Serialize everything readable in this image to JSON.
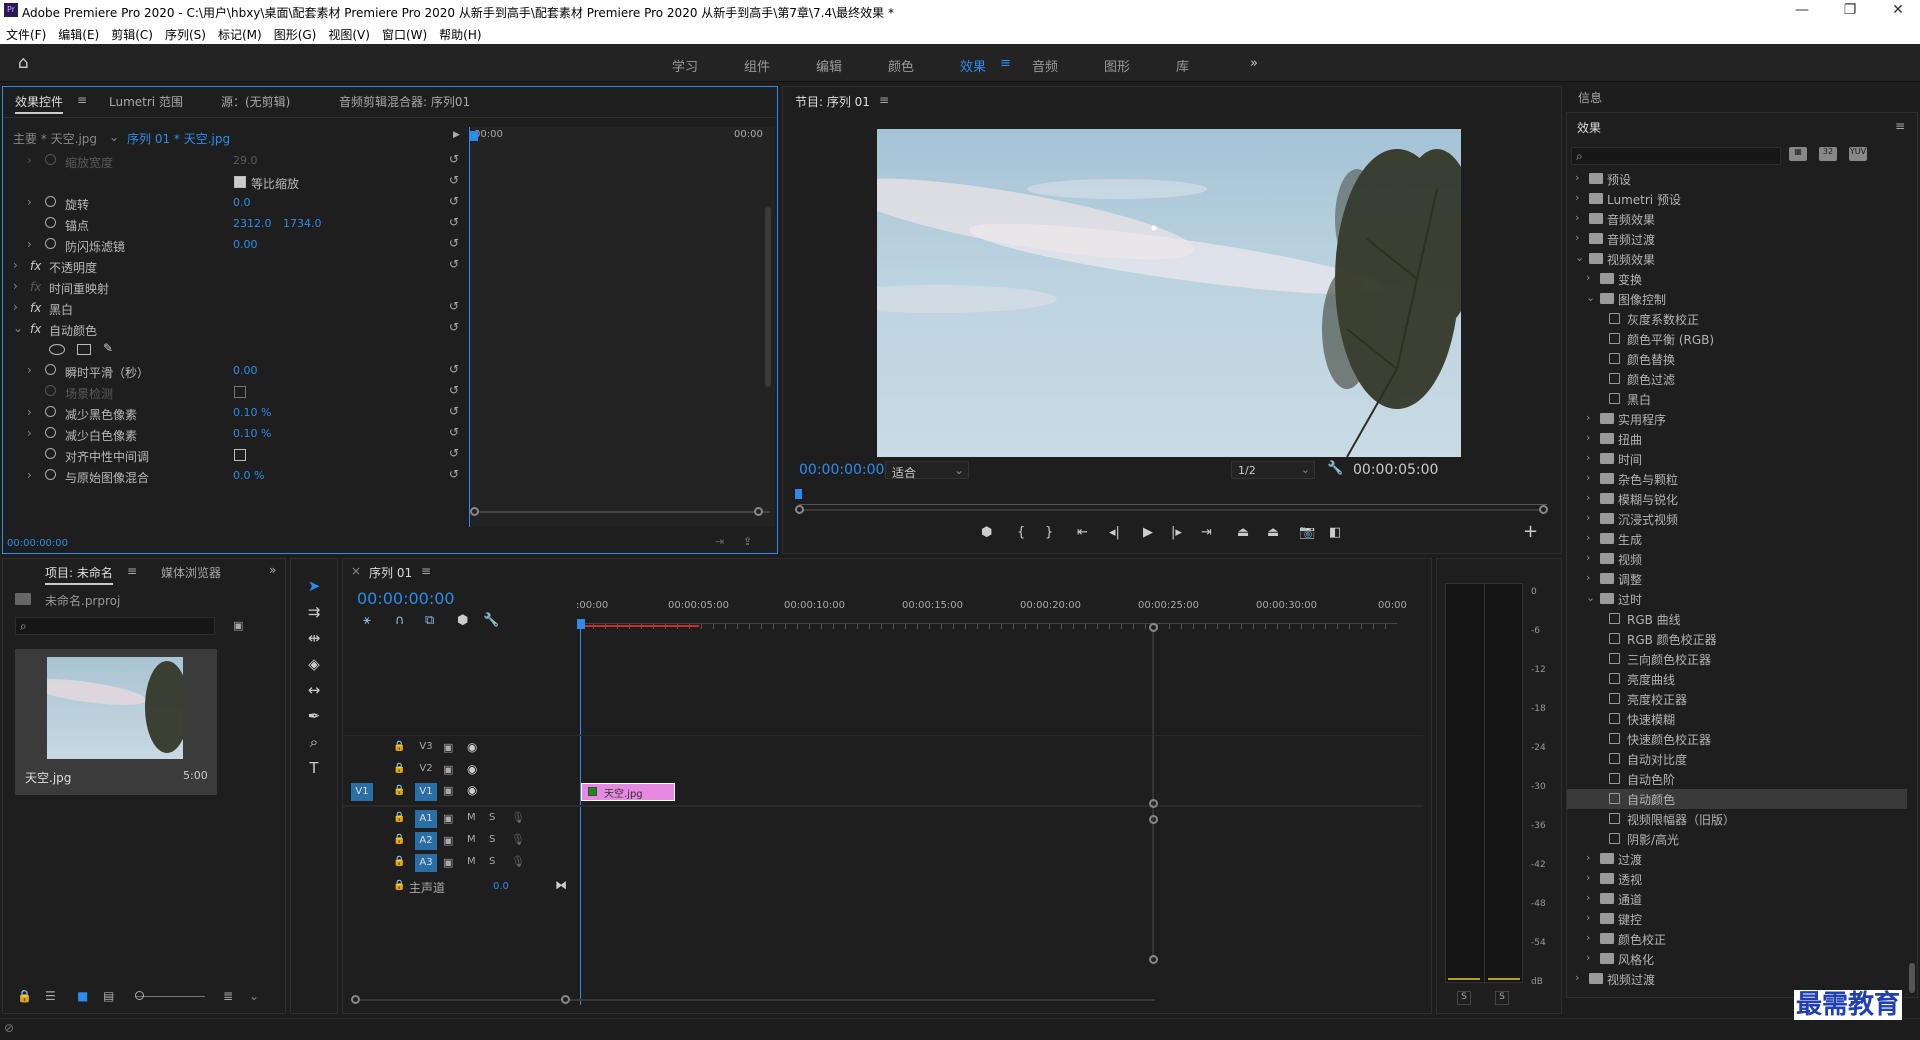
{
  "window": {
    "title": "Adobe Premiere Pro 2020 - C:\\用户\\hbxy\\桌面\\配套素材 Premiere Pro 2020 从新手到高手\\配套素材 Premiere Pro 2020 从新手到高手\\第7章\\7.4\\最终效果 *"
  },
  "menu": [
    "文件(F)",
    "编辑(E)",
    "剪辑(C)",
    "序列(S)",
    "标记(M)",
    "图形(G)",
    "视图(V)",
    "窗口(W)",
    "帮助(H)"
  ],
  "workspaces": [
    "学习",
    "组件",
    "编辑",
    "颜色",
    "效果",
    "音频",
    "图形",
    "库"
  ],
  "effect_controls": {
    "tabs": [
      "效果控件",
      "Lumetri 范围",
      "源：(无剪辑)",
      "音频剪辑混合器: 序列01"
    ],
    "master": "主要 * 天空.jpg",
    "sequence": "序列 01 * 天空.jpg",
    "t_start": "00:00",
    "t_end": "00:00",
    "rows": [
      {
        "label": "缩放宽度",
        "v1": "29.0",
        "dim": true
      },
      {
        "label": "等比缩放",
        "check": true
      },
      {
        "label": "旋转",
        "v1": "0.0"
      },
      {
        "label": "锚点",
        "v1": "2312.0",
        "v2": "1734.0"
      },
      {
        "label": "防闪烁滤镜",
        "v1": "0.00"
      },
      {
        "label": "不透明度",
        "fx": true
      },
      {
        "label": "时间重映射",
        "fx": true
      },
      {
        "label": "黑白",
        "fx": true
      },
      {
        "label": "自动颜色",
        "fx": true
      },
      {
        "label": "masks"
      },
      {
        "label": "瞬时平滑（秒）",
        "v1": "0.00"
      },
      {
        "label": "场景检测",
        "dim": true,
        "cb": true
      },
      {
        "label": "减少黑色像素",
        "v1": "0.10 %"
      },
      {
        "label": "减少白色像素",
        "v1": "0.10 %"
      },
      {
        "label": "对齐中性中间调",
        "cb": true
      },
      {
        "label": "与原始图像混合",
        "v1": "0.0 %"
      }
    ],
    "timecode": "00:00:00:00"
  },
  "program": {
    "title": "节目: 序列 01",
    "timecode": "00:00:00:00",
    "fit": "适合",
    "quality": "1/2",
    "duration": "00:00:05:00"
  },
  "project": {
    "tabs": [
      "项目: 未命名",
      "媒体浏览器"
    ],
    "file": "未命名.prproj",
    "clip_name": "天空.jpg",
    "clip_duration": "5:00"
  },
  "timeline": {
    "tab": "序列 01",
    "timecode": "00:00:00:00",
    "ruler": [
      ":00:00",
      "00:00:05:00",
      "00:00:10:00",
      "00:00:15:00",
      "00:00:20:00",
      "00:00:25:00",
      "00:00:30:00",
      "00:00"
    ],
    "video_tracks": [
      "V3",
      "V2",
      "V1"
    ],
    "audio_tracks": [
      "A1",
      "A2",
      "A3"
    ],
    "master": "主声道",
    "master_val": "0.0",
    "clip": "天空.jpg"
  },
  "meter": {
    "scale": [
      "0",
      "-6",
      "-12",
      "-18",
      "-24",
      "-30",
      "-36",
      "-42",
      "-48",
      "-54",
      "dB"
    ],
    "solo": [
      "S",
      "S"
    ]
  },
  "info": {
    "title": "信息"
  },
  "effects": {
    "title": "效果",
    "tree": [
      {
        "t": "预设",
        "lv": 0,
        "ar": "›",
        "ic": "folder"
      },
      {
        "t": "Lumetri 预设",
        "lv": 0,
        "ar": "›",
        "ic": "folder"
      },
      {
        "t": "音频效果",
        "lv": 0,
        "ar": "›",
        "ic": "folder"
      },
      {
        "t": "音频过渡",
        "lv": 0,
        "ar": "›",
        "ic": "folder"
      },
      {
        "t": "视频效果",
        "lv": 0,
        "ar": "⌄",
        "ic": "folder"
      },
      {
        "t": "变换",
        "lv": 1,
        "ar": "›",
        "ic": "folder"
      },
      {
        "t": "图像控制",
        "lv": 1,
        "ar": "⌄",
        "ic": "folder"
      },
      {
        "t": "灰度系数校正",
        "lv": 2,
        "ic": "fx"
      },
      {
        "t": "颜色平衡 (RGB)",
        "lv": 2,
        "ic": "fx"
      },
      {
        "t": "颜色替换",
        "lv": 2,
        "ic": "fx"
      },
      {
        "t": "颜色过滤",
        "lv": 2,
        "ic": "fx"
      },
      {
        "t": "黑白",
        "lv": 2,
        "ic": "fx"
      },
      {
        "t": "实用程序",
        "lv": 1,
        "ar": "›",
        "ic": "folder"
      },
      {
        "t": "扭曲",
        "lv": 1,
        "ar": "›",
        "ic": "folder"
      },
      {
        "t": "时间",
        "lv": 1,
        "ar": "›",
        "ic": "folder"
      },
      {
        "t": "杂色与颗粒",
        "lv": 1,
        "ar": "›",
        "ic": "folder"
      },
      {
        "t": "模糊与锐化",
        "lv": 1,
        "ar": "›",
        "ic": "folder"
      },
      {
        "t": "沉浸式视频",
        "lv": 1,
        "ar": "›",
        "ic": "folder"
      },
      {
        "t": "生成",
        "lv": 1,
        "ar": "›",
        "ic": "folder"
      },
      {
        "t": "视频",
        "lv": 1,
        "ar": "›",
        "ic": "folder"
      },
      {
        "t": "调整",
        "lv": 1,
        "ar": "›",
        "ic": "folder"
      },
      {
        "t": "过时",
        "lv": 1,
        "ar": "⌄",
        "ic": "folder"
      },
      {
        "t": "RGB 曲线",
        "lv": 2,
        "ic": "fx"
      },
      {
        "t": "RGB 颜色校正器",
        "lv": 2,
        "ic": "fx"
      },
      {
        "t": "三向颜色校正器",
        "lv": 2,
        "ic": "fx"
      },
      {
        "t": "亮度曲线",
        "lv": 2,
        "ic": "fx"
      },
      {
        "t": "亮度校正器",
        "lv": 2,
        "ic": "fx"
      },
      {
        "t": "快速模糊",
        "lv": 2,
        "ic": "fx"
      },
      {
        "t": "快速颜色校正器",
        "lv": 2,
        "ic": "fx"
      },
      {
        "t": "自动对比度",
        "lv": 2,
        "ic": "fx"
      },
      {
        "t": "自动色阶",
        "lv": 2,
        "ic": "fx"
      },
      {
        "t": "自动颜色",
        "lv": 2,
        "ic": "fx",
        "sel": true
      },
      {
        "t": "视频限幅器（旧版）",
        "lv": 2,
        "ic": "fx"
      },
      {
        "t": "阴影/高光",
        "lv": 2,
        "ic": "fx"
      },
      {
        "t": "过渡",
        "lv": 1,
        "ar": "›",
        "ic": "folder"
      },
      {
        "t": "透视",
        "lv": 1,
        "ar": "›",
        "ic": "folder"
      },
      {
        "t": "通道",
        "lv": 1,
        "ar": "›",
        "ic": "folder"
      },
      {
        "t": "键控",
        "lv": 1,
        "ar": "›",
        "ic": "folder"
      },
      {
        "t": "颜色校正",
        "lv": 1,
        "ar": "›",
        "ic": "folder"
      },
      {
        "t": "风格化",
        "lv": 1,
        "ar": "›",
        "ic": "folder"
      },
      {
        "t": "视频过渡",
        "lv": 0,
        "ar": "›",
        "ic": "folder"
      }
    ]
  },
  "watermark": "最需教育",
  "colors": {
    "accent": "#2d8ceb",
    "clip": "#e58ae0",
    "playhead": "#2d8ceb",
    "in_out": "#d02a2a"
  }
}
